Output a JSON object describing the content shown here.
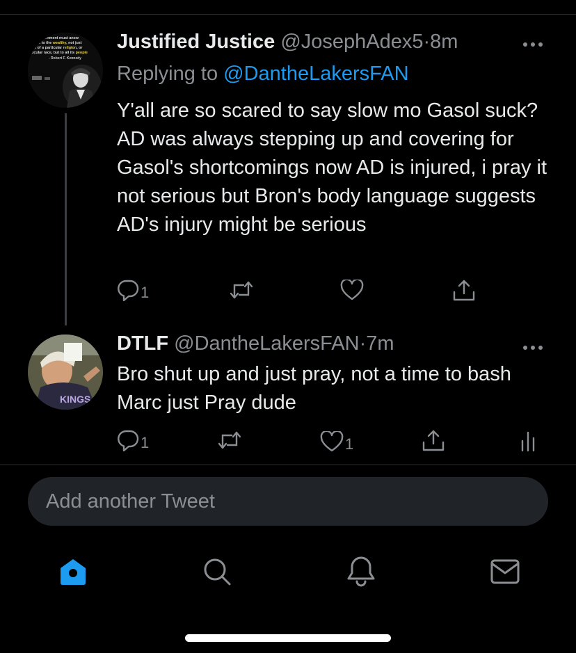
{
  "tweets": [
    {
      "name": "Justified Justice",
      "handle": "@JosephAdex5",
      "separator": "·",
      "time": "8m",
      "replying_prefix": "Replying to ",
      "replying_to": "@DantheLakersFAN",
      "text": "Y'all are so scared to say slow mo Gasol suck? AD was always stepping up and covering for Gasol's shortcomings now AD is injured, i pray it not serious but Bron's body language suggests AD's injury  might be serious",
      "reply_count": "1",
      "retweet_count": "",
      "like_count": "",
      "avatar_quote": {
        "line1": "overnment must answ",
        "line2a": "ust to the ",
        "line2b": "wealthy",
        "line2c": ", not just",
        "line3": "se of a particular ",
        "line3b": "religion",
        "line3c": ", or",
        "line4a": "rticular race, but to all its ",
        "line4b": "people",
        "line5": "- Robert F. Kennedy"
      }
    },
    {
      "name": "DTLF",
      "handle": "@DantheLakersFAN",
      "separator": "·",
      "time": "7m",
      "text": "Bro shut up and just pray, not a time to bash Marc just Pray dude",
      "reply_count": "1",
      "retweet_count": "",
      "like_count": "1"
    }
  ],
  "compose": {
    "placeholder": "Add another Tweet"
  },
  "colors": {
    "background": "#000000",
    "accent": "#1d9bf0",
    "secondary_text": "#8b8f94",
    "divider": "#2f3336"
  },
  "icons": {
    "more": "ellipsis-icon",
    "reply": "reply-icon",
    "retweet": "retweet-icon",
    "like": "heart-icon",
    "share": "share-icon",
    "analytics": "analytics-icon",
    "home": "home-icon",
    "search": "search-icon",
    "notifications": "bell-icon",
    "messages": "mail-icon"
  }
}
